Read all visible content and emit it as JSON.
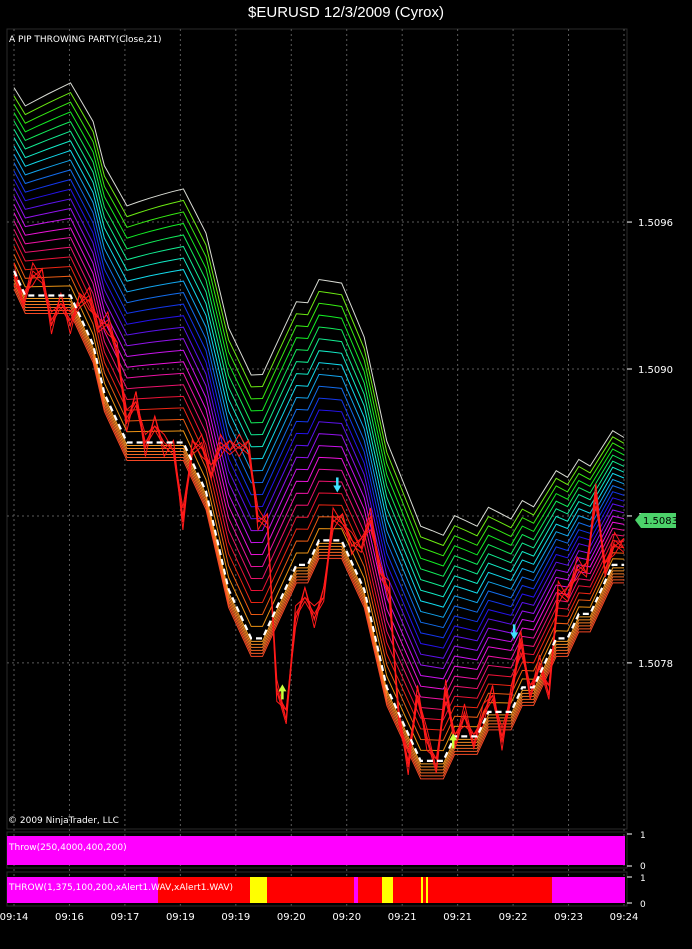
{
  "window": {
    "title": "$EURUSD  12/3/2009 (Cyrox)"
  },
  "main_panel": {
    "indicator_label": "A PIP THROWING PARTY(Close,21)",
    "copyright": "© 2009 NinjaTrader, LLC",
    "last_price_tag": "1.5083"
  },
  "panels": {
    "throw_label": "Throw(250,4000,400,200)",
    "throw2_label": "THROW(1,375,100,200,xAlert1.WAV,xAlert1.WAV)",
    "scale_top": "1",
    "scale_bottom": "0"
  },
  "colors": {
    "background": "#000000",
    "price": "#ff1a1a",
    "magenta": "#ff00ff",
    "red_bar": "#ff0000",
    "yellow_bar": "#ffff00",
    "price_tag": "#4cd26a",
    "up_arrow": "#c8ff3c",
    "down_arrow": "#40e0ff"
  },
  "chart_data": {
    "type": "line",
    "title": "$EURUSD  12/3/2009 (Cyrox)",
    "y_ticks": [
      "1.5096",
      "1.5090",
      "1.5084",
      "1.5078"
    ],
    "y_tick_values": [
      1.5096,
      1.509,
      1.5084,
      1.5078
    ],
    "ylim": [
      1.50713,
      1.51038
    ],
    "x_tick_labels": [
      "09:14",
      "09:16",
      "09:17",
      "09:19",
      "09:19",
      "09:20",
      "09:20",
      "09:21",
      "09:21",
      "09:22",
      "09:23",
      "09:24"
    ],
    "grid": true,
    "series": [
      {
        "name": "Close",
        "values": [
          1.5094,
          1.5093,
          1.5094,
          1.5094,
          1.5092,
          1.5093,
          1.5092,
          1.5093,
          1.5093,
          1.5092,
          1.5092,
          1.5091,
          1.5088,
          1.5089,
          1.5087,
          1.5088,
          1.5087,
          1.5087,
          1.5084,
          1.5087,
          1.5087,
          1.5086,
          1.5087,
          1.5087,
          1.5087,
          1.5087,
          1.5084,
          1.5084,
          1.5077,
          1.5076,
          1.508,
          1.5081,
          1.508,
          1.5081,
          1.5084,
          1.5084,
          1.5083,
          1.5083,
          1.5084,
          1.5082,
          1.5081,
          1.5076,
          1.5074,
          1.5077,
          1.5075,
          1.5074,
          1.5077,
          1.5075,
          1.5076,
          1.5075,
          1.5076,
          1.5077,
          1.5075,
          1.5077,
          1.5079,
          1.5077,
          1.5078,
          1.5077,
          1.5081,
          1.5081,
          1.5082,
          1.5082,
          1.5085,
          1.5082,
          1.5083,
          1.5083
        ]
      },
      {
        "name": "PIP THROWING PARTY",
        "values": [
          1.5094,
          1.5093,
          1.5093,
          1.5093,
          1.5093,
          1.5093,
          1.5092,
          1.5091,
          1.5089,
          1.5088,
          1.5087,
          1.5087,
          1.5087,
          1.5087,
          1.5087,
          1.5087,
          1.5086,
          1.5085,
          1.5083,
          1.5081,
          1.508,
          1.5079,
          1.5079,
          1.508,
          1.5081,
          1.5082,
          1.5082,
          1.5083,
          1.5083,
          1.5083,
          1.5082,
          1.5081,
          1.5079,
          1.5077,
          1.5076,
          1.5075,
          1.5074,
          1.5074,
          1.5074,
          1.5075,
          1.5075,
          1.5075,
          1.5076,
          1.5076,
          1.5076,
          1.5077,
          1.5077,
          1.5078,
          1.5079,
          1.5079,
          1.508,
          1.508,
          1.5081,
          1.5082,
          1.5082
        ]
      }
    ],
    "signals": [
      {
        "type": "up",
        "x_index": 0.44,
        "y": 1.5077
      },
      {
        "type": "down",
        "x_index": 0.53,
        "y": 1.5085
      },
      {
        "type": "up",
        "x_index": 0.72,
        "y": 1.5075
      },
      {
        "type": "down",
        "x_index": 0.82,
        "y": 1.5079
      }
    ]
  }
}
